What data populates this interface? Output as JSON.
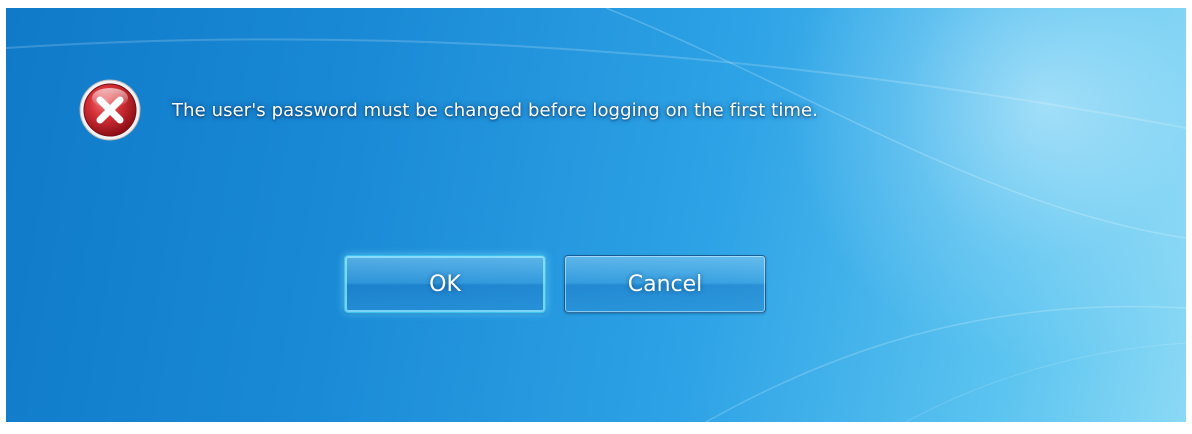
{
  "dialog": {
    "message": "The user's password must be changed before logging on the first time.",
    "icon": "error-icon",
    "buttons": {
      "ok_label": "OK",
      "cancel_label": "Cancel"
    }
  },
  "colors": {
    "background_primary": "#1a8ad6",
    "background_highlight": "#8bd9f5",
    "error_red": "#c8232c",
    "text": "#ffffff"
  }
}
